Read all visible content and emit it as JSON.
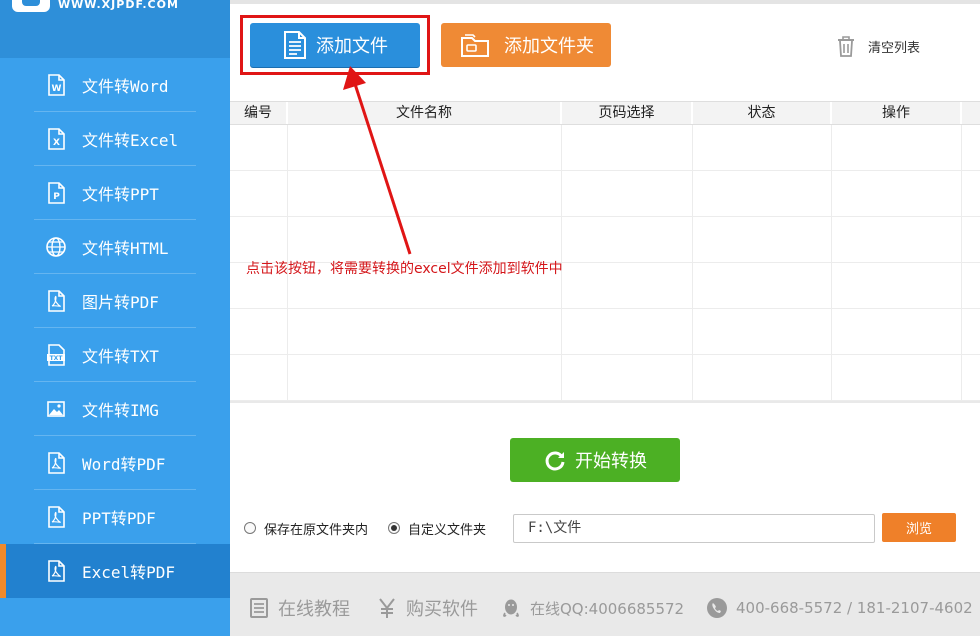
{
  "brand": {
    "site_text": "WWW.XJPDF.COM"
  },
  "sidebar": {
    "items": [
      {
        "label": "文件转Word",
        "icon": "word-file-icon"
      },
      {
        "label": "文件转Excel",
        "icon": "excel-file-icon"
      },
      {
        "label": "文件转PPT",
        "icon": "ppt-file-icon"
      },
      {
        "label": "文件转HTML",
        "icon": "globe-icon"
      },
      {
        "label": "图片转PDF",
        "icon": "pdf-file-icon"
      },
      {
        "label": "文件转TXT",
        "icon": "txt-file-icon"
      },
      {
        "label": "文件转IMG",
        "icon": "image-icon"
      },
      {
        "label": "Word转PDF",
        "icon": "pdf-file-icon"
      },
      {
        "label": "PPT转PDF",
        "icon": "pdf-file-icon"
      },
      {
        "label": "Excel转PDF",
        "icon": "pdf-file-icon",
        "active": true
      }
    ]
  },
  "toolbar": {
    "add_file_label": "添加文件",
    "add_folder_label": "添加文件夹",
    "clear_list_label": "清空列表"
  },
  "table": {
    "headers": [
      "编号",
      "文件名称",
      "页码选择",
      "状态",
      "操作"
    ],
    "rows": []
  },
  "annotation": {
    "text": "点击该按钮，将需要转换的excel文件添加到软件中"
  },
  "convert": {
    "start_label": "开始转换"
  },
  "output": {
    "option_original": "保存在原文件夹内",
    "option_custom": "自定义文件夹",
    "selected": "custom",
    "path_value": "F:\\文件",
    "browse_label": "浏览"
  },
  "footer": {
    "tutorial": "在线教程",
    "buy": "购买软件",
    "qq": "在线QQ:4006685572",
    "phone": "400-668-5572 / 181-2107-4602"
  },
  "colors": {
    "sidebar": "#3aa0ec",
    "sidebar_active": "#2281cf",
    "accent_orange": "#ef8a35",
    "primary_blue": "#2a8fdc",
    "start_green": "#4cb024",
    "annotation_red": "#d4161a"
  }
}
